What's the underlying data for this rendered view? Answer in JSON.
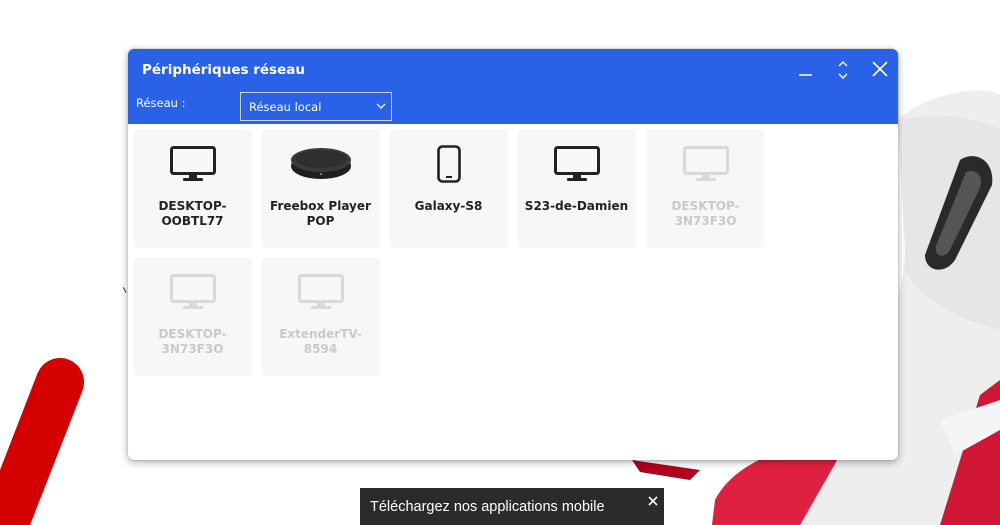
{
  "dialog": {
    "title": "Périphériques réseau",
    "network_label": "Réseau :",
    "network_select": {
      "value": "Réseau local"
    },
    "controls": {
      "minimize": "minimize-icon",
      "maximize": "expand-icon",
      "close": "close-icon"
    }
  },
  "devices": [
    {
      "name": "DESKTOP-OOBTL77",
      "icon": "monitor-icon",
      "status": "online"
    },
    {
      "name": "Freebox Player POP",
      "icon": "freebox-player-icon",
      "status": "online"
    },
    {
      "name": "Galaxy-S8",
      "icon": "smartphone-icon",
      "status": "online"
    },
    {
      "name": "S23-de-Damien",
      "icon": "monitor-icon",
      "status": "online"
    },
    {
      "name": "DESKTOP-3N73F3O",
      "icon": "monitor-icon",
      "status": "offline"
    },
    {
      "name": "DESKTOP-3N73F3O",
      "icon": "monitor-icon",
      "status": "offline"
    },
    {
      "name": "ExtenderTV-8594",
      "icon": "monitor-icon",
      "status": "offline"
    }
  ],
  "toast": {
    "text": "Téléchargez nos applications mobile"
  },
  "colors": {
    "header": "#2962e6",
    "brand_red": "#d40000",
    "online_icon": "#222222",
    "offline_icon": "#d9d9d9"
  }
}
